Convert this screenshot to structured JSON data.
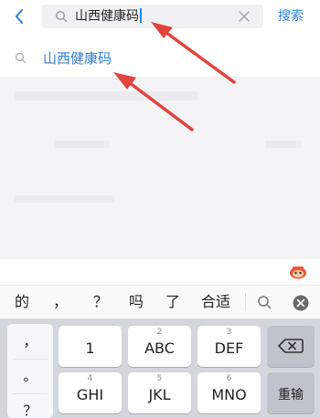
{
  "search": {
    "query": "山西健康码",
    "action_label": "搜索"
  },
  "suggestion": {
    "label": "山西健康码"
  },
  "candidates": [
    "的",
    "，",
    "？",
    "吗",
    "了",
    "合适"
  ],
  "keyboard": {
    "punctuation": [
      "，",
      "。",
      "？"
    ],
    "keys": [
      {
        "main": "1",
        "sub": ""
      },
      {
        "main": "ABC",
        "sub": "2"
      },
      {
        "main": "DEF",
        "sub": "3"
      },
      {
        "main": "GHI",
        "sub": "4"
      },
      {
        "main": "JKL",
        "sub": "5"
      },
      {
        "main": "MNO",
        "sub": "6"
      }
    ],
    "reenter_label": "重输"
  },
  "colors": {
    "accent": "#2f7fd8",
    "annotation": "#e0443e"
  }
}
